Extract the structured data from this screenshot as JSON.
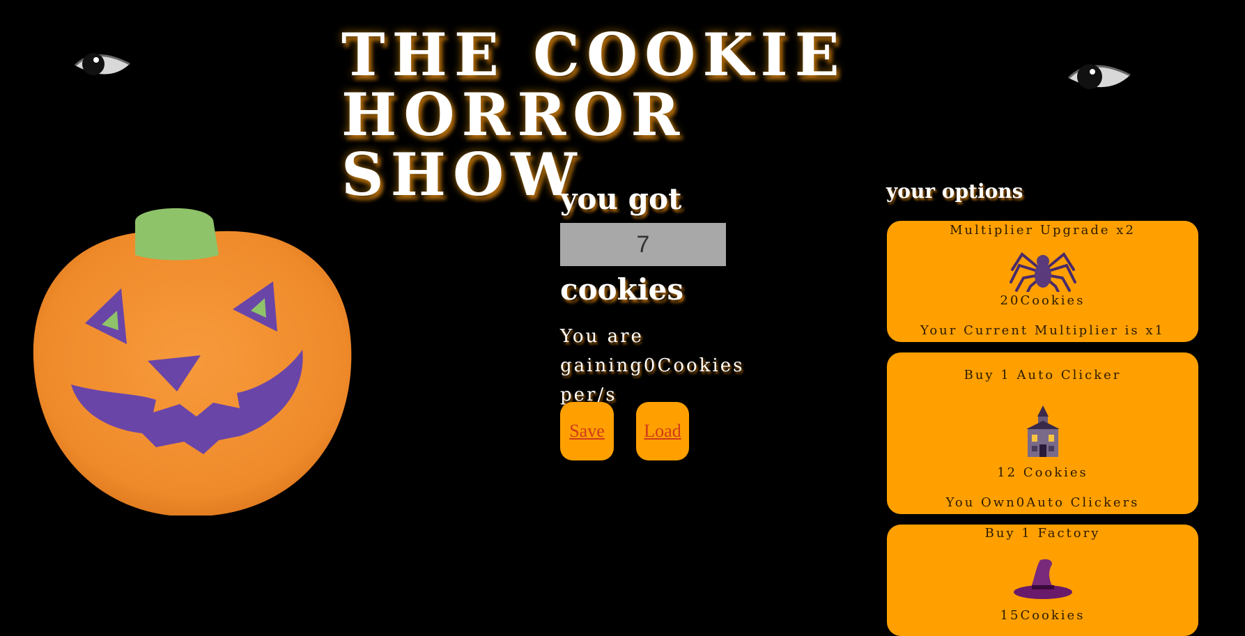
{
  "header": {
    "title": "THE COOKIE HORROR SHOW"
  },
  "counter": {
    "you_got_label": "you got",
    "count": "7",
    "cookies_label": "cookies",
    "rate_prefix": "You are",
    "rate_line": "gaining0Cookies per/s"
  },
  "actions": {
    "save_label": "Save",
    "load_label": "Load"
  },
  "options": {
    "title": "your options",
    "items": [
      {
        "title": "Multiplier Upgrade x2",
        "icon": "spider-icon",
        "cost": "20Cookies",
        "info": "Your Current Multiplier is x1"
      },
      {
        "title": "Buy 1 Auto Clicker",
        "icon": "haunted-house-icon",
        "cost": "12 Cookies",
        "info": "You Own0Auto Clickers"
      },
      {
        "title": "Buy 1 Factory",
        "icon": "witch-hat-icon",
        "cost": "15Cookies",
        "info": ""
      }
    ]
  },
  "colors": {
    "background": "#000000",
    "accent": "#ffa000",
    "link": "#d13a1a",
    "counter_box": "#a8a8a8"
  }
}
